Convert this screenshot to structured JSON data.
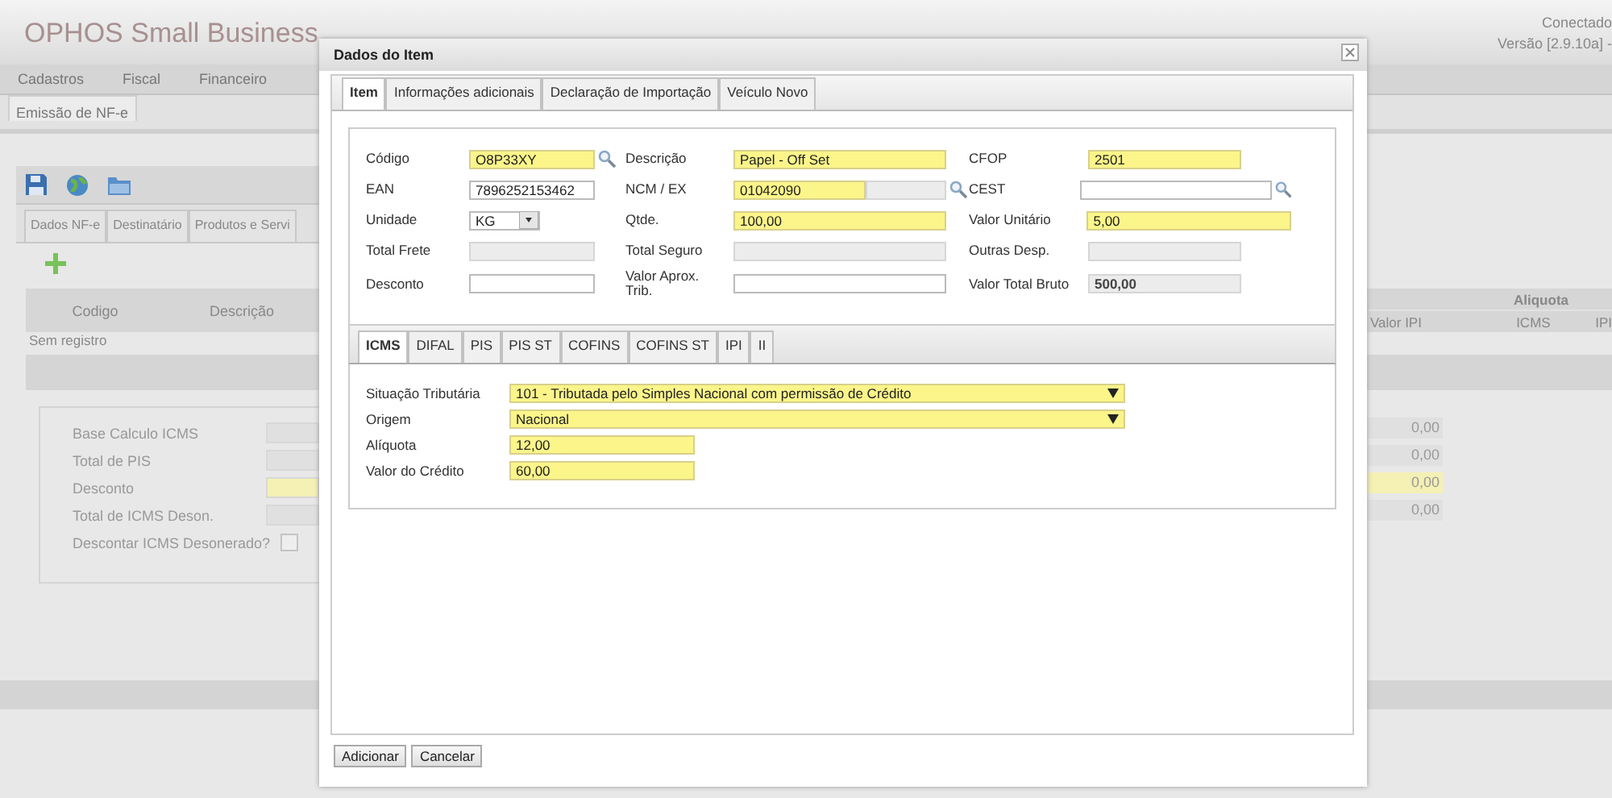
{
  "app": {
    "title": "OPHOS Small Business",
    "status": "Conectado",
    "version": "Versão [2.9.10a] -"
  },
  "menu": [
    "Cadastros",
    "Fiscal",
    "Financeiro"
  ],
  "page_tabs": [
    {
      "label": "Emissão de NF-e",
      "selected": true
    }
  ],
  "form_tabs": [
    "Dados NF-e",
    "Destinatário",
    "Produtos e Servi"
  ],
  "table": {
    "columns": [
      "Codigo",
      "Descrição"
    ],
    "group_header": "Aliquota",
    "right_columns": [
      "Valor IPI",
      "ICMS",
      "IPI"
    ],
    "empty_text": "Sem registro"
  },
  "totals": [
    {
      "label": "Base Calculo ICMS",
      "value": "0,00",
      "highlighted": false
    },
    {
      "label": "Total de PIS",
      "value": "0,00",
      "highlighted": false
    },
    {
      "label": "Desconto",
      "value": "0,00",
      "highlighted": true
    },
    {
      "label": "Total de ICMS Deson.",
      "value": "0,00",
      "highlighted": false
    }
  ],
  "desonerado": {
    "label": "Descontar ICMS Desonerado?",
    "checked": false
  },
  "dialog": {
    "title": "Dados do Item",
    "tabs": [
      {
        "label": "Item",
        "selected": true
      },
      {
        "label": "Informações adicionais",
        "selected": false
      },
      {
        "label": "Declaração de Importação",
        "selected": false
      },
      {
        "label": "Veículo Novo",
        "selected": false
      }
    ],
    "fields": [
      {
        "label": "Código",
        "value": "O8P33XY",
        "kind": "text",
        "required": true,
        "disabled": false,
        "search": true
      },
      {
        "label": "Descrição",
        "value": "Papel - Off Set",
        "kind": "text",
        "required": true,
        "disabled": false
      },
      {
        "label": "CFOP",
        "value": "2501",
        "kind": "text",
        "required": true,
        "disabled": false
      },
      {
        "label": "EAN",
        "value": "7896252153462",
        "kind": "text",
        "required": false,
        "disabled": false
      },
      {
        "label": "NCM / EX",
        "value": "01042090",
        "kind": "text",
        "required": true,
        "disabled": false,
        "search": true,
        "ex_field": true
      },
      {
        "label": "CEST",
        "kind": "text",
        "required": false,
        "disabled": false,
        "search": true
      },
      {
        "label": "Unidade",
        "value": "KG",
        "kind": "select",
        "required": false,
        "disabled": false
      },
      {
        "label": "Qtde.",
        "value": "100,00",
        "kind": "text",
        "required": true,
        "disabled": false
      },
      {
        "label": "Valor Unitário",
        "value": "5,00",
        "kind": "text",
        "required": true,
        "disabled": false
      },
      {
        "label": "Total Frete",
        "kind": "text",
        "disabled": true
      },
      {
        "label": "Total Seguro",
        "kind": "text",
        "disabled": true
      },
      {
        "label": "Outras Desp.",
        "kind": "text",
        "disabled": true
      },
      {
        "label": "Desconto",
        "kind": "text",
        "required": false,
        "disabled": false
      },
      {
        "label": "Valor Aprox. Trib.",
        "kind": "text",
        "required": false,
        "disabled": false
      },
      {
        "label": "Valor Total Bruto",
        "value": "500,00",
        "kind": "text",
        "disabled": true
      }
    ],
    "tax_tabs": [
      {
        "label": "ICMS",
        "selected": true
      },
      {
        "label": "DIFAL",
        "selected": false
      },
      {
        "label": "PIS",
        "selected": false
      },
      {
        "label": "PIS ST",
        "selected": false
      },
      {
        "label": "COFINS",
        "selected": false
      },
      {
        "label": "COFINS ST",
        "selected": false
      },
      {
        "label": "IPI",
        "selected": false
      },
      {
        "label": "II",
        "selected": false
      }
    ],
    "tax_fields": [
      {
        "label": "Situação Tributária",
        "value": "101 - Tributada pelo Simples Nacional com permissão de Crédito",
        "kind": "select",
        "required": true
      },
      {
        "label": "Origem",
        "value": "Nacional",
        "kind": "select",
        "required": true
      },
      {
        "label": "Alíquota",
        "value": "12,00",
        "kind": "text",
        "required": true
      },
      {
        "label": "Valor do Crédito",
        "value": "60,00",
        "kind": "text",
        "required": true
      }
    ],
    "buttons": [
      "Adicionar",
      "Cancelar"
    ]
  }
}
